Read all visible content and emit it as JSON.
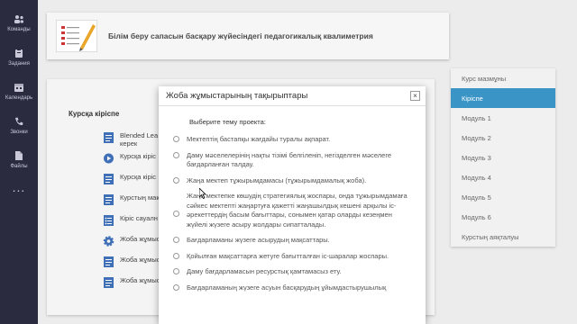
{
  "rail": {
    "items": [
      {
        "label": "Команды",
        "icon": "teams-icon"
      },
      {
        "label": "Задания",
        "icon": "assignments-icon"
      },
      {
        "label": "Календарь",
        "icon": "calendar-icon"
      },
      {
        "label": "Звонки",
        "icon": "calls-icon"
      },
      {
        "label": "Файлы",
        "icon": "files-icon"
      }
    ],
    "more": "..."
  },
  "header": {
    "title": "Білім беру сапасын басқару жүйесіндегі педагогикалық квалиметрия"
  },
  "course": {
    "intro_title": "Курсқа кіріспе",
    "lessons": [
      {
        "label": "Blended Lea керек",
        "icon": "document-icon"
      },
      {
        "label": "Курсқа кіріс",
        "icon": "play-icon"
      },
      {
        "label": "Курсқа кіріс",
        "icon": "document-icon"
      },
      {
        "label": "Курстың мақ",
        "icon": "document-icon"
      },
      {
        "label": "Кіріс сауалн",
        "icon": "list-icon"
      },
      {
        "label": "Жоба жұмыс",
        "icon": "gear-icon"
      },
      {
        "label": "Жоба жұмыс",
        "icon": "document-icon"
      },
      {
        "label": "Жоба жұмыс",
        "icon": "document-icon"
      }
    ]
  },
  "menu": {
    "items": [
      "Курс мазмұны",
      "Кіріспе",
      "Модуль 1",
      "Модуль 2",
      "Модуль 3",
      "Модуль 4",
      "Модуль 5",
      "Модуль 6",
      "Курстың аяқталуы"
    ],
    "active_index": 1
  },
  "modal": {
    "title": "Жоба жұмыстарының тақырыптары",
    "close": "×",
    "subtitle": "Выберите тему проекта:",
    "options": [
      "Мектептің бастапқы жағдайы туралы ақпарат.",
      "Даму мәселелерінің нақты тізімі белгіленіп, негізделген мәселеге бағдарланған талдау.",
      "Жаңа мектеп тұжырымдамасы (тұжырымдамалық жоба).",
      "Жаңа мектепке көшудің стратегиялық жоспары, онда тұжырымдамаға сәйкес мектепті жаңартуға қажетті жаңашылдық кешені арқылы іс-әрекеттердің басым бағыттары, сонымен қатар оларды кезеңмен жүйелі жүзеге асыру жолдары сипатталады.",
      "Бағдарламаны жүзеге асырудың мақсаттары.",
      "Қойылған мақсаттарға жетуге бағытталған іс-шаралар жоспары.",
      "Даму бағдарламасын ресурстық қамтамасыз ету.",
      "Бағдарламаның жүзеге асуын басқарудың ұйымдастырушылық"
    ]
  },
  "colors": {
    "accent": "#3a95c6",
    "rail": "#2b2b40"
  }
}
